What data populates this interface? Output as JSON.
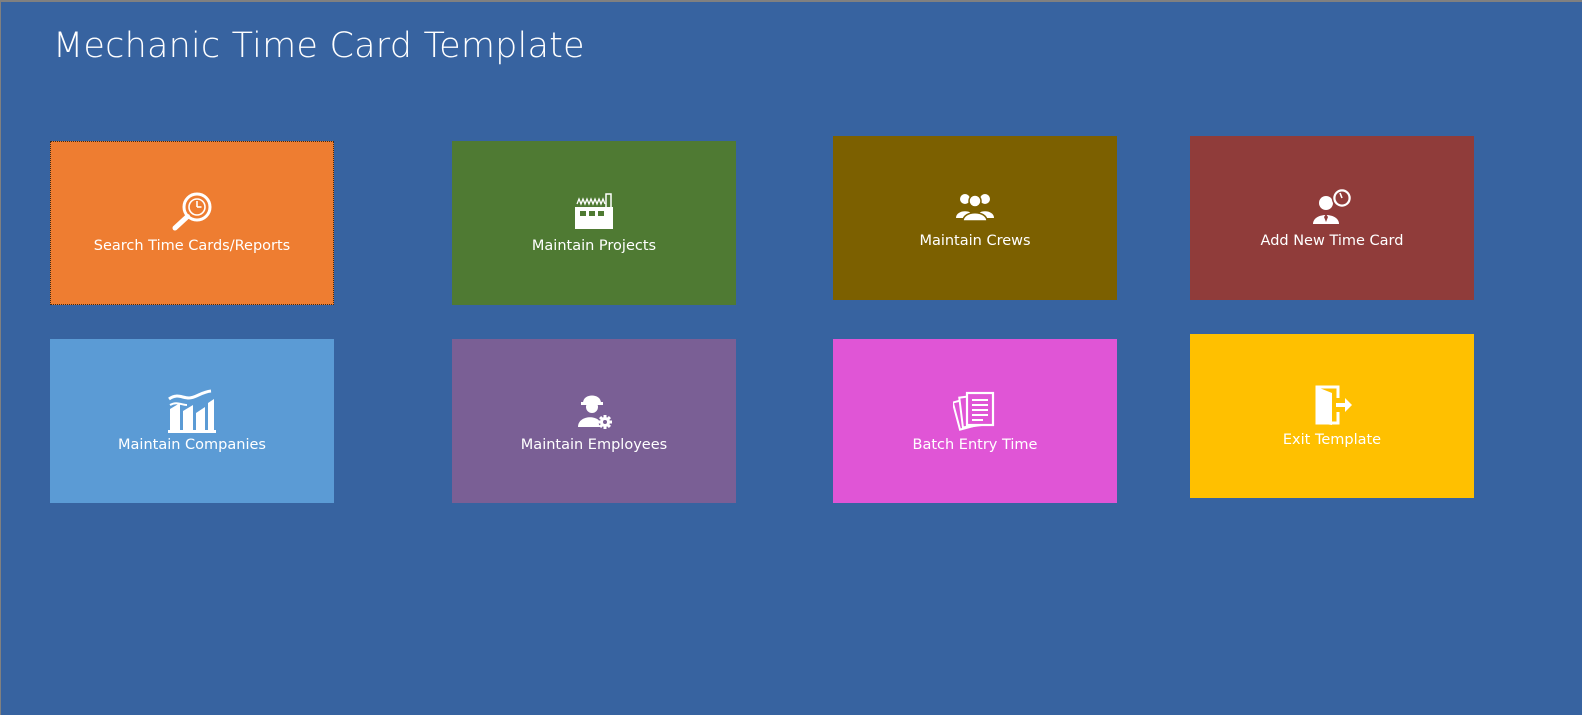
{
  "app": {
    "title": "Mechanic Time Card Template"
  },
  "tiles": [
    {
      "id": "search",
      "label": "Search Time Cards/Reports",
      "color": "#ee7d31",
      "icon": "search-clock-icon"
    },
    {
      "id": "projects",
      "label": "Maintain Projects",
      "color": "#4f7a33",
      "icon": "factory-icon"
    },
    {
      "id": "crews",
      "label": "Maintain Crews",
      "color": "#7c6000",
      "icon": "crew-group-icon"
    },
    {
      "id": "new-time-card",
      "label": "Add New Time Card",
      "color": "#903c3a",
      "icon": "person-clock-icon"
    },
    {
      "id": "companies",
      "label": "Maintain Companies",
      "color": "#5b9bd5",
      "icon": "company-building-icon"
    },
    {
      "id": "employees",
      "label": "Maintain Employees",
      "color": "#7a5f95",
      "icon": "worker-gear-icon"
    },
    {
      "id": "batch-entry",
      "label": "Batch Entry Time",
      "color": "#e055d6",
      "icon": "documents-icon"
    },
    {
      "id": "exit",
      "label": "Exit Template",
      "color": "#ffc000",
      "icon": "exit-door-icon"
    }
  ]
}
